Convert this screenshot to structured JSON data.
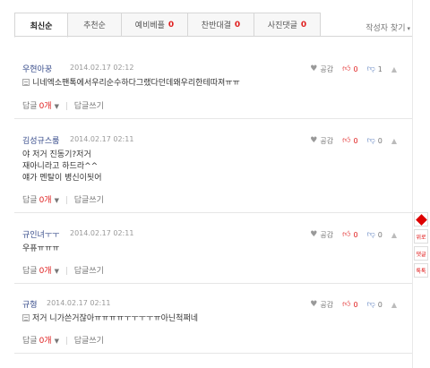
{
  "tabs": [
    {
      "label": "최신순",
      "count": ""
    },
    {
      "label": "추천순",
      "count": ""
    },
    {
      "label": "예비베플",
      "count": "0"
    },
    {
      "label": "찬반대결",
      "count": "0"
    },
    {
      "label": "사진댓글",
      "count": "0"
    }
  ],
  "author_find": "작성자 찾기",
  "comments": [
    {
      "nick": "우현아꿍",
      "time": "2014.02.17 02:12",
      "lines": [
        "니네엑소팬톡에서우리순수하다그랬다던데왜우리한테따져ㅠㅠ"
      ],
      "has_mark": true,
      "like_label": "공감",
      "up": "0",
      "down": "1",
      "reply_label": "답글",
      "reply_count": "0개",
      "write_label": "답글쓰기"
    },
    {
      "nick": "김성규스룸",
      "time": "2014.02.17 02:11",
      "lines": [
        "야 저거 진동기?저거",
        "재아니라고 하드라^^",
        "얘가 멘탈이 병신이됫어"
      ],
      "has_mark": false,
      "like_label": "공감",
      "up": "0",
      "down": "0",
      "reply_label": "답글",
      "reply_count": "0개",
      "write_label": "답글쓰기"
    },
    {
      "nick": "규인녀ㅜㅜ",
      "time": "2014.02.17 02:11",
      "lines": [
        "우퓨ㅠㅠㅠ"
      ],
      "has_mark": false,
      "like_label": "공감",
      "up": "0",
      "down": "0",
      "reply_label": "답글",
      "reply_count": "0개",
      "write_label": "답글쓰기"
    },
    {
      "nick": "규형",
      "time": "2014.02.17 02:11",
      "lines": [
        "저거 니가쓴거잖아ㅠㅠㅠㅠㅜㅜㅜㅜㅠ아닌척쩌네"
      ],
      "has_mark": true,
      "like_label": "공감",
      "up": "0",
      "down": "0",
      "reply_label": "답글",
      "reply_count": "0개",
      "write_label": "답글쓰기"
    }
  ],
  "sidebar": {
    "btn1": "위로",
    "btn2": "댓글",
    "btn3": "톡톡"
  },
  "colors": {
    "accent": "#e02020",
    "nick": "#3a4e8c"
  }
}
